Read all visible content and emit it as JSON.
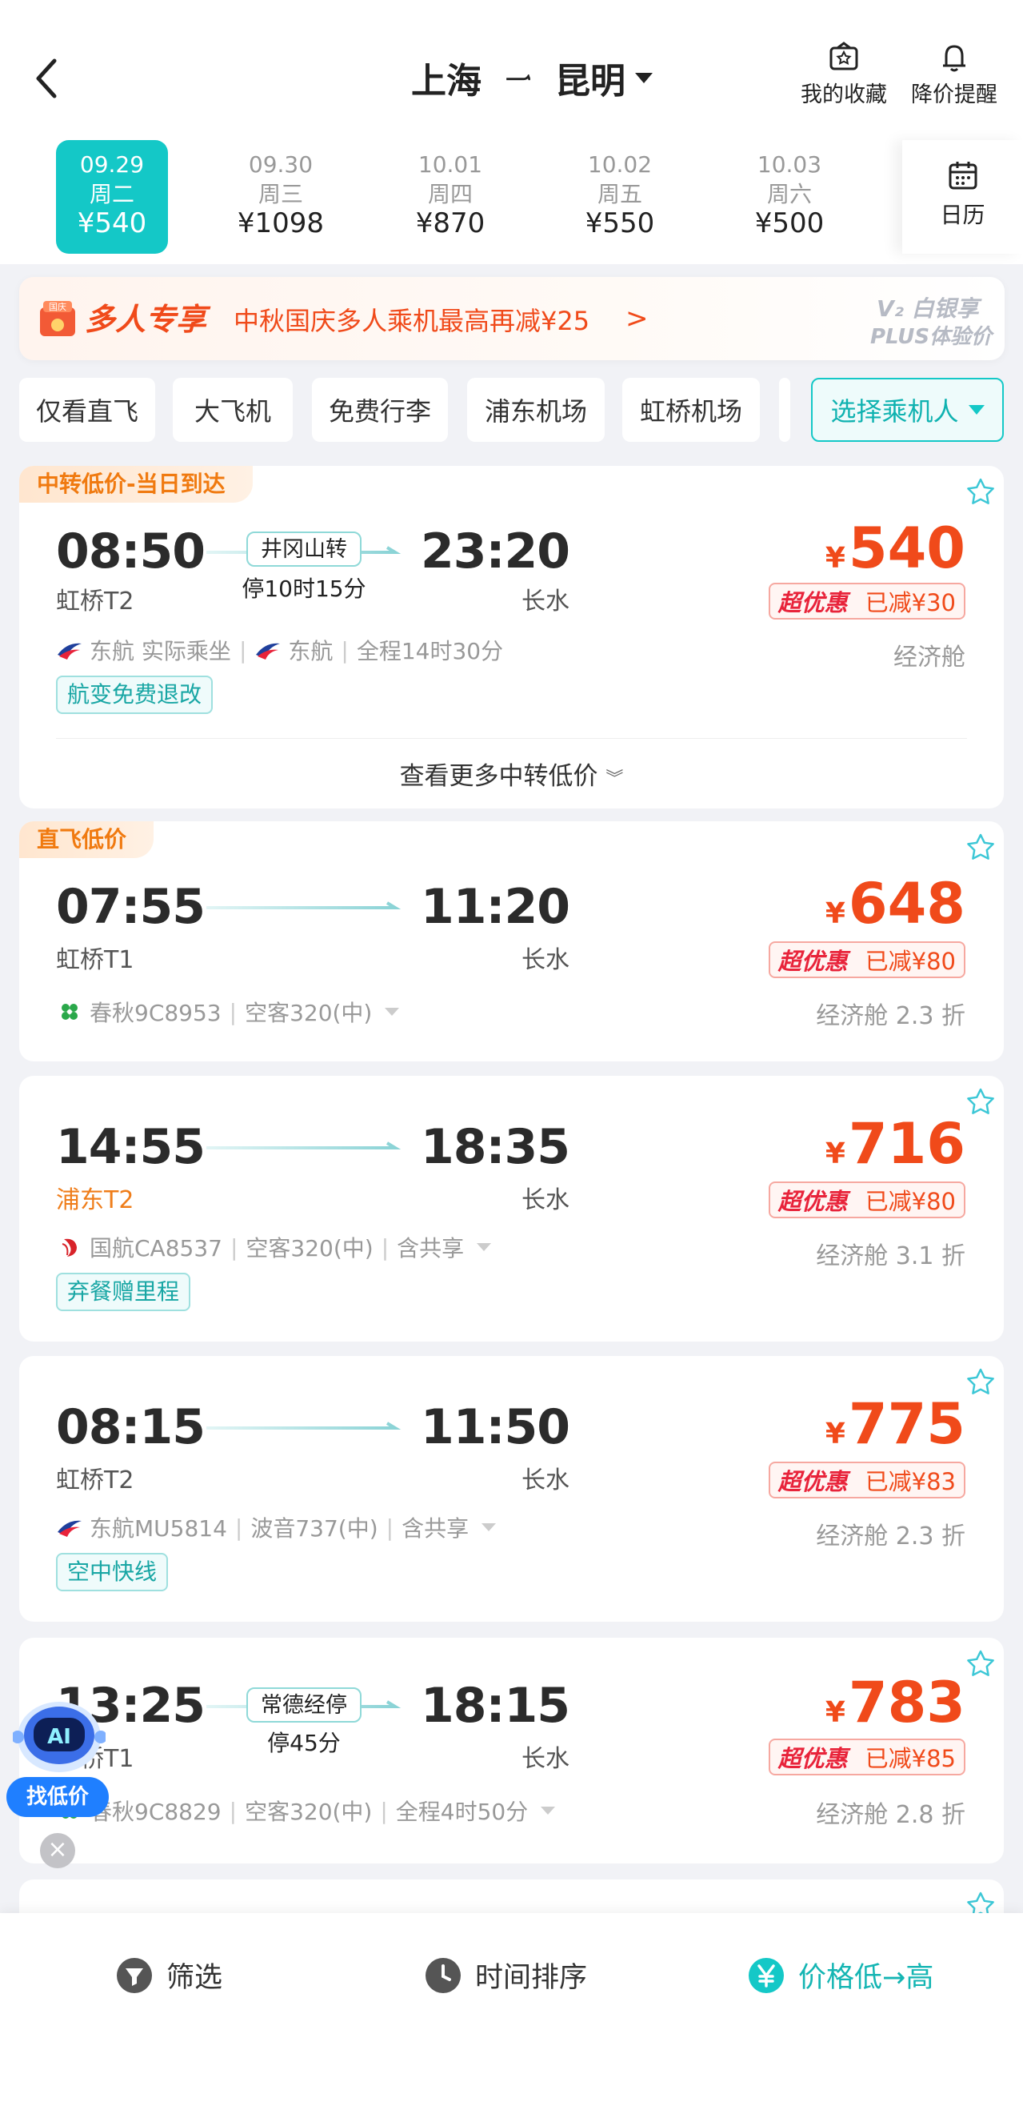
{
  "header": {
    "origin": "上海",
    "destination": "昆明",
    "favorites_label": "我的收藏",
    "price_alert_label": "降价提醒"
  },
  "dates": [
    {
      "date": "09.29",
      "weekday": "周二",
      "price": "¥540",
      "selected": true
    },
    {
      "date": "09.30",
      "weekday": "周三",
      "price": "¥1098"
    },
    {
      "date": "10.01",
      "weekday": "周四",
      "price": "¥870"
    },
    {
      "date": "10.02",
      "weekday": "周五",
      "price": "¥550"
    },
    {
      "date": "10.03",
      "weekday": "周六",
      "price": "¥500"
    }
  ],
  "calendar_label": "日历",
  "promo": {
    "icon_text": "国庆",
    "title": "多人专享",
    "text": "中秋国庆多人乘机最高再减¥25",
    "arrow": ">",
    "plus_line1": "V₂ 白银享",
    "plus_line2": "PLUS体验价"
  },
  "filters": [
    "仅看直飞",
    "大飞机",
    "免费行李",
    "浦东机场",
    "虹桥机场"
  ],
  "passenger_filter": "选择乘机人",
  "flights": [
    {
      "tag": "中转低价-当日到达",
      "dep_time": "08:50",
      "arr_time": "23:20",
      "dep_terminal": "虹桥T2",
      "arr_terminal": "长水",
      "stop": "井冈山转",
      "stop_duration": "停10时15分",
      "airline1": "东航",
      "airline1_note": "实际乘坐",
      "airline2": "东航",
      "total": "全程14时30分",
      "price": "540",
      "currency": "¥",
      "badge_left": "超优惠",
      "badge_right": "已减¥30",
      "cabin": "经济舱",
      "service": "航变免费退改",
      "more": "查看更多中转低价"
    },
    {
      "tag": "直飞低价",
      "dep_time": "07:55",
      "arr_time": "11:20",
      "dep_terminal": "虹桥T1",
      "arr_terminal": "长水",
      "airline": "春秋9C8953",
      "aircraft": "空客320(中)",
      "price": "648",
      "currency": "¥",
      "badge_left": "超优惠",
      "badge_right": "已减¥80",
      "cabin": "经济舱 2.3 折"
    },
    {
      "dep_time": "14:55",
      "arr_time": "18:35",
      "dep_terminal": "浦东T2",
      "arr_terminal": "长水",
      "airline": "国航CA8537",
      "aircraft": "空客320(中)",
      "share": "含共享",
      "price": "716",
      "currency": "¥",
      "badge_left": "超优惠",
      "badge_right": "已减¥80",
      "cabin": "经济舱 3.1 折",
      "service": "弃餐赠里程"
    },
    {
      "dep_time": "08:15",
      "arr_time": "11:50",
      "dep_terminal": "虹桥T2",
      "arr_terminal": "长水",
      "airline": "东航MU5814",
      "aircraft": "波音737(中)",
      "share": "含共享",
      "price": "775",
      "currency": "¥",
      "badge_left": "超优惠",
      "badge_right": "已减¥83",
      "cabin": "经济舱 2.3 折",
      "service": "空中快线"
    },
    {
      "dep_time": "13:25",
      "arr_time": "18:15",
      "dep_terminal": "虹桥T1",
      "arr_terminal": "长水",
      "stop": "常德经停",
      "stop_duration": "停45分",
      "airline": "春秋9C8829",
      "aircraft": "空客320(中)",
      "total": "全程4时50分",
      "price": "783",
      "currency": "¥",
      "badge_left": "超优惠",
      "badge_right": "已减¥85",
      "cabin": "经济舱 2.8 折"
    }
  ],
  "ai_assistant": {
    "icon_text": "AI",
    "label": "找低价"
  },
  "bottom_bar": {
    "filter": "筛选",
    "time_sort": "时间排序",
    "price_sort": "价格低→高"
  },
  "colors": {
    "accent": "#14c8c7",
    "price": "#f04a1a",
    "tag_orange": "#f07a10",
    "ai_blue": "#1f7fff"
  }
}
